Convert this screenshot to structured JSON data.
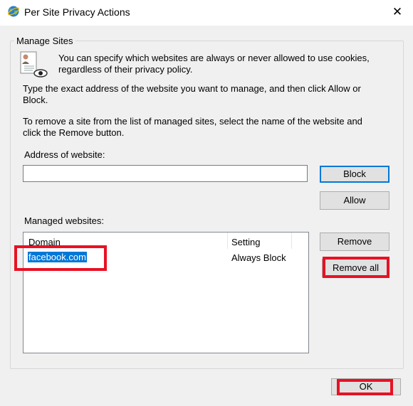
{
  "window": {
    "title": "Per Site Privacy Actions",
    "close_glyph": "✕",
    "icon": "ie-globe-icon"
  },
  "manage_sites": {
    "legend": "Manage Sites",
    "icon": "privacy-document-eye-icon",
    "intro": "You can specify which websites are always or never allowed to use cookies, regardless of their privacy policy.",
    "instruction_manage": "Type the exact address of the website you want to manage, and then click Allow or Block.",
    "instruction_remove": "To remove a site from the list of managed sites, select the name of the website and click the Remove button.",
    "address_label": "Address of website:",
    "address_value": "",
    "managed_label": "Managed websites:"
  },
  "buttons": {
    "block": "Block",
    "allow": "Allow",
    "remove": "Remove",
    "remove_all": "Remove all",
    "ok": "OK"
  },
  "table": {
    "columns": [
      "Domain",
      "Setting"
    ],
    "rows": [
      {
        "domain": "facebook.com",
        "setting": "Always Block",
        "selected": true
      }
    ]
  },
  "highlight_color": "#e81123",
  "accent_color": "#0078d7"
}
